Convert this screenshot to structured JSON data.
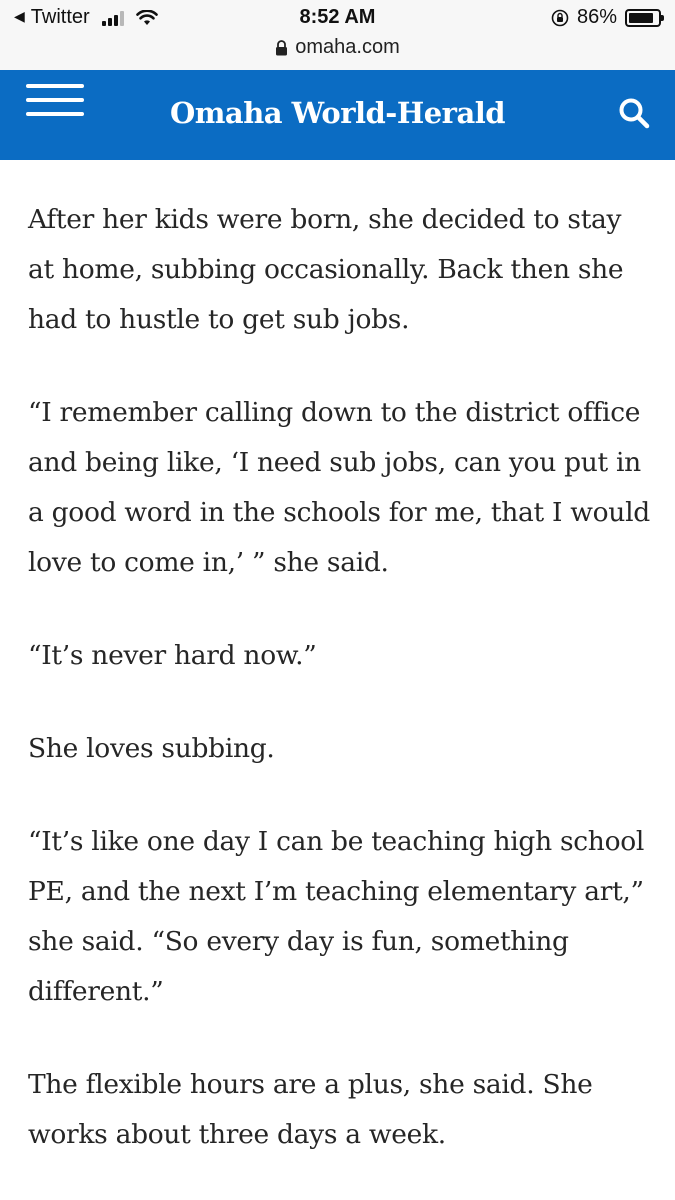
{
  "status_bar": {
    "back_app": "Twitter",
    "time": "8:52 AM",
    "url": "omaha.com",
    "battery": "86%",
    "battery_level": 0.86,
    "signal_bars": 3
  },
  "header": {
    "logo": "Omaha World-Herald",
    "menu_icon": "hamburger-menu-icon",
    "search_icon": "search-icon",
    "background_color": "#0b6cc3"
  },
  "article": {
    "paragraphs": [
      "After her kids were born, she decided to stay at home, subbing occasionally. Back then she had to hustle to get sub jobs.",
      "“I remember calling down to the district office and being like, ‘I need sub jobs, can you put in a good word in the schools for me, that I would love to come in,’ ” she said.",
      "“It’s never hard now.”",
      "She loves subbing.",
      "“It’s like one day I can be teaching high school PE, and the next I’m teaching elementary art,” she said. “So every day is fun, something different.”",
      "The flexible hours are a plus, she said. She works about three days a week."
    ]
  }
}
